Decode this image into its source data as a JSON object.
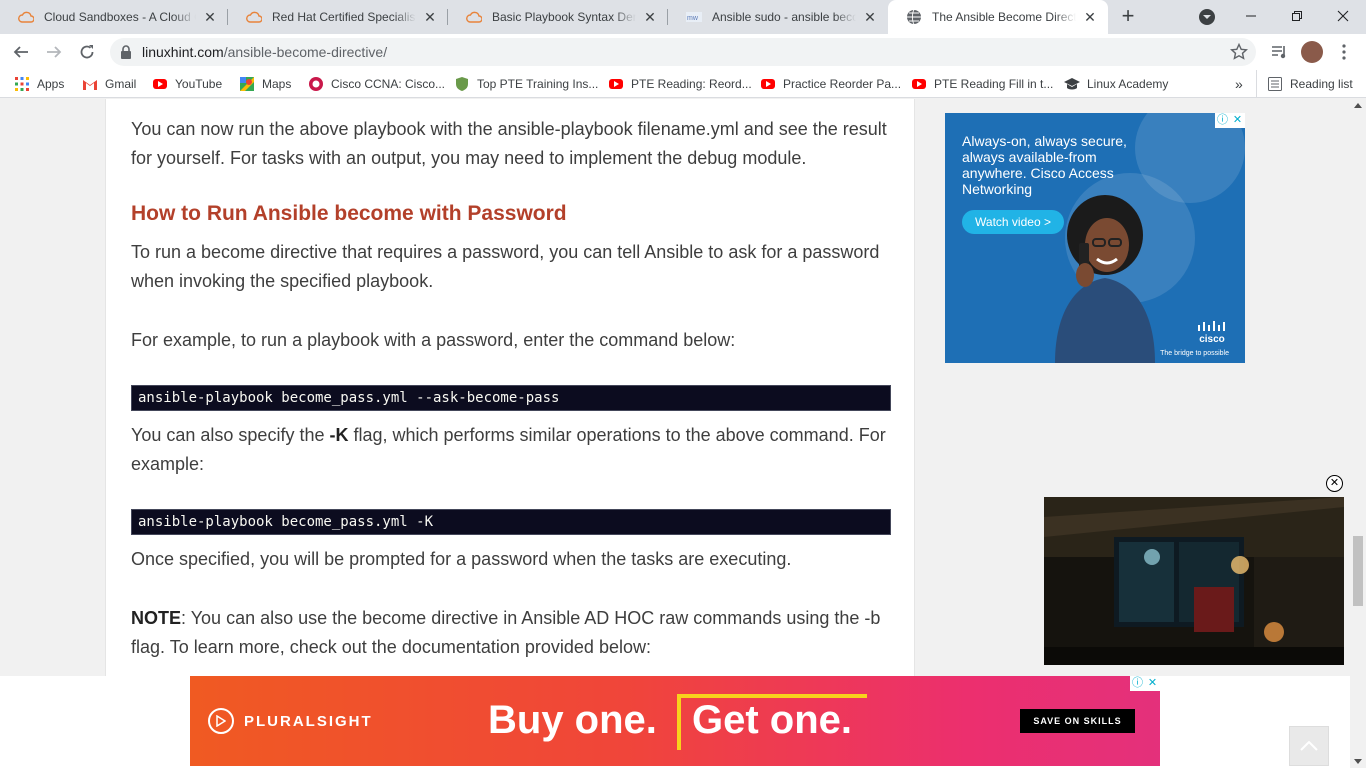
{
  "tabs": [
    {
      "title": "Cloud Sandboxes - A Cloud G",
      "icon": "cloud-icon"
    },
    {
      "title": "Red Hat Certified Specialist in",
      "icon": "cloud-icon"
    },
    {
      "title": "Basic Playbook Syntax Demo",
      "icon": "cloud-icon"
    },
    {
      "title": "Ansible sudo - ansible becom",
      "icon": "site-icon"
    },
    {
      "title": "The Ansible Become Directive",
      "icon": "globe-icon"
    }
  ],
  "address": {
    "host": "linuxhint.com",
    "path": "/ansible-become-directive/"
  },
  "bookmarks": [
    {
      "label": "Apps"
    },
    {
      "label": "Gmail"
    },
    {
      "label": "YouTube"
    },
    {
      "label": "Maps"
    },
    {
      "label": "Cisco CCNA: Cisco..."
    },
    {
      "label": "Top PTE Training Ins..."
    },
    {
      "label": "PTE Reading: Reord..."
    },
    {
      "label": "Practice Reorder Pa..."
    },
    {
      "label": "PTE Reading Fill in t..."
    },
    {
      "label": "Linux Academy"
    }
  ],
  "overflow_label": "»",
  "reading_list": "Reading list",
  "article": {
    "p1": "You can now run the above playbook with the ansible-playbook filename.yml and see the result for yourself. For tasks with an output, you may need to implement the debug module.",
    "heading": "How to Run Ansible become with Password",
    "p2": "To run a become directive that requires a password, you can tell Ansible to ask for a password when invoking the specified playbook.",
    "p3": "For example, to run a playbook with a password, enter the command below:",
    "code1": "ansible-playbook become_pass.yml --ask-become-pass",
    "p4a": "You can also specify the ",
    "p4b": "-K",
    "p4c": " flag, which performs similar operations to the above command. For example:",
    "code2": "ansible-playbook become_pass.yml -K",
    "p5": "Once specified, you will be prompted for a password when the tasks are executing.",
    "note_label": "NOTE",
    "note_text": ": You can also use the become directive in Ansible AD HOC raw commands using the -b flag. To learn more, check out the documentation provided below:"
  },
  "side_ad": {
    "text": "Always-on, always secure, always available-from anywhere. Cisco Access Networking",
    "button": "Watch video >",
    "brand": "cisco",
    "tagline": "The bridge to possible",
    "bg": "#1e6fb5"
  },
  "bottom_ad": {
    "brand": "PLURALSIGHT",
    "part1": "Buy one.",
    "part2": "Get one.",
    "cta": "SAVE ON SKILLS"
  },
  "colors": {
    "heading": "#b3402a",
    "code_bg": "#0c0c1f",
    "text": "#3e3e3e"
  }
}
